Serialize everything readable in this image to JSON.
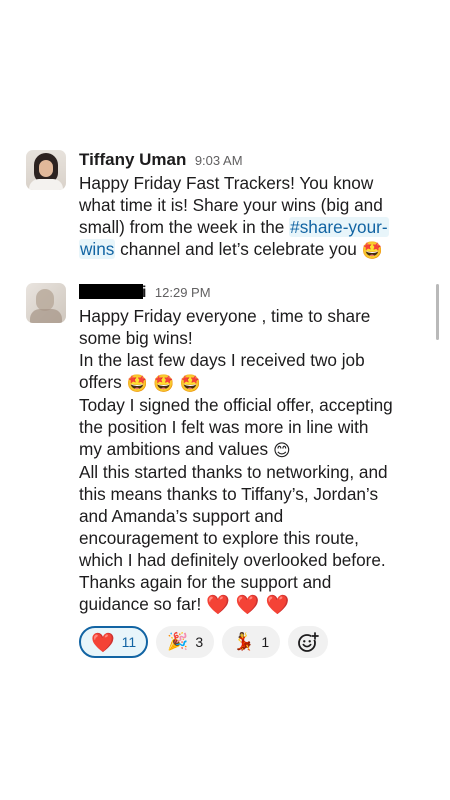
{
  "messages": [
    {
      "author": "Tiffany Uman",
      "time": "9:03 AM",
      "avatar_icon": "profile-photo",
      "lines": {
        "l1": "Happy Friday Fast Trackers! You know",
        "l2": "what time it is! Share your wins (big and",
        "l3_pre": "small) from the week in the ",
        "link_part1": "#share-your-",
        "link_part2": "wins",
        "l4_post": " channel and let’s celebrate you ",
        "emoji": "🤩"
      }
    },
    {
      "author_visible_suffix": "i",
      "time": "12:29 PM",
      "avatar_icon": "profile-photo",
      "lines": {
        "l1": "Happy Friday everyone , time to share",
        "l2": "some big wins!",
        "l3": "In the last few days I received two job",
        "l4": "offers ",
        "offer_emojis": "🤩 🤩 🤩",
        "l5": "Today I signed the official offer, accepting",
        "l6": "the position I felt was more in line with",
        "l7": "my ambitions and values ",
        "values_emoji": "😊",
        "l8": "All this started thanks to networking, and",
        "l9": "this means thanks to Tiffany’s, Jordan’s",
        "l10": "and Amanda’s support and",
        "l11": "encouragement to explore this route,",
        "l12": "which I had definitely overlooked before.",
        "l13": "Thanks again for the support and",
        "l14": "guidance so far! ",
        "hearts": "❤️ ❤️ ❤️"
      }
    }
  ],
  "reactions": [
    {
      "emoji": "❤️",
      "count": "11",
      "icon": "heart-icon",
      "active": true
    },
    {
      "emoji": "🎉",
      "count": "3",
      "icon": "party-popper-icon",
      "active": false
    },
    {
      "emoji": "💃",
      "count": "1",
      "icon": "dancer-icon",
      "active": false
    }
  ],
  "colors": {
    "link": "#1264a3",
    "heart": "#e01e3c",
    "active_reaction_border": "#1264a3",
    "timestamp": "#616061"
  }
}
